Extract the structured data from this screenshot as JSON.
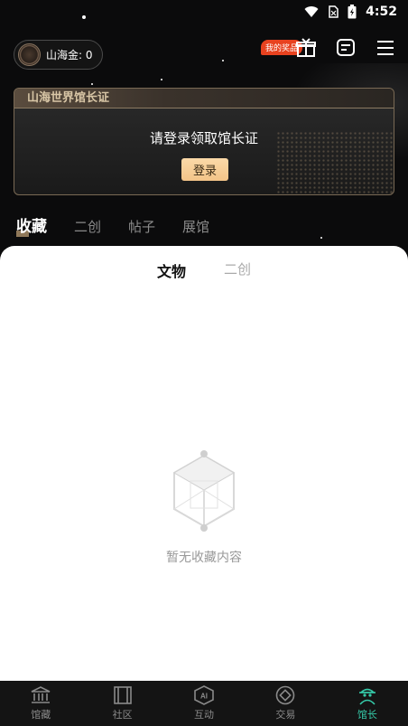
{
  "status_bar": {
    "time": "4:52"
  },
  "header": {
    "coin_label": "山海金: 0",
    "prize_badge": "我的奖品"
  },
  "card": {
    "title": "山海世界馆长证",
    "message": "请登录领取馆长证",
    "login_button": "登录"
  },
  "tabs": [
    {
      "label": "收藏",
      "active": true
    },
    {
      "label": "二创",
      "active": false
    },
    {
      "label": "帖子",
      "active": false
    },
    {
      "label": "展馆",
      "active": false
    }
  ],
  "subtabs": [
    {
      "label": "文物",
      "active": true
    },
    {
      "label": "二创",
      "active": false
    }
  ],
  "empty_state": {
    "text": "暂无收藏内容"
  },
  "bottom_nav": [
    {
      "label": "馆藏",
      "icon": "museum-icon",
      "active": false
    },
    {
      "label": "社区",
      "icon": "scroll-icon",
      "active": false
    },
    {
      "label": "互动",
      "icon": "ai-icon",
      "active": false
    },
    {
      "label": "交易",
      "icon": "coin-icon",
      "active": false
    },
    {
      "label": "馆长",
      "icon": "curator-icon",
      "active": true
    }
  ],
  "colors": {
    "accent": "#35c9a8",
    "button": "#f3c488",
    "badge": "#e8421f"
  }
}
